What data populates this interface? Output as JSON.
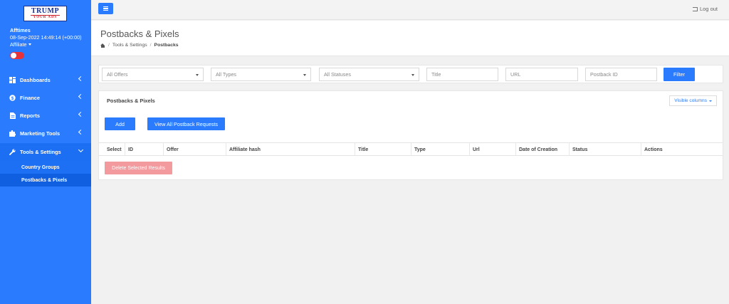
{
  "sidebar": {
    "logo": {
      "line1": "TRUMP",
      "line2": "YOUR ADS"
    },
    "user": {
      "name": "Afftimes",
      "datetime": "08-Sep-2022 14:49:14 (+00:00)",
      "role": "Affiliate"
    },
    "nav": [
      {
        "label": "Dashboards",
        "icon": "dashboard-icon"
      },
      {
        "label": "Finance",
        "icon": "finance-icon"
      },
      {
        "label": "Reports",
        "icon": "reports-icon"
      },
      {
        "label": "Marketing Tools",
        "icon": "puzzle-icon"
      },
      {
        "label": "Tools & Settings",
        "icon": "wrench-icon"
      }
    ],
    "subnav": [
      {
        "label": "Country Groups"
      },
      {
        "label": "Postbacks & Pixels"
      }
    ]
  },
  "topbar": {
    "logout_label": "Log out"
  },
  "header": {
    "title": "Postbacks & Pixels",
    "breadcrumb": [
      "Tools & Settings",
      "Postbacks"
    ]
  },
  "filters": {
    "offers": "All Offers",
    "types": "All Types",
    "statuses": "All Statuses",
    "title_placeholder": "Title",
    "url_placeholder": "URL",
    "postback_id_placeholder": "Postback ID",
    "filter_label": "Filter"
  },
  "panel": {
    "title": "Postbacks & Pixels",
    "visible_columns_label": "Visible columns",
    "add_label": "Add",
    "view_all_label": "View All Postback Requests",
    "delete_label": "Delete Selected Results",
    "columns": [
      "Select",
      "ID",
      "Offer",
      "Affiliate hash",
      "Title",
      "Type",
      "Url",
      "Date of Creation",
      "Status",
      "Actions"
    ]
  },
  "colors": {
    "accent": "#2b7bff",
    "danger_light": "#f29a9e",
    "toggle": "#e8323a"
  }
}
